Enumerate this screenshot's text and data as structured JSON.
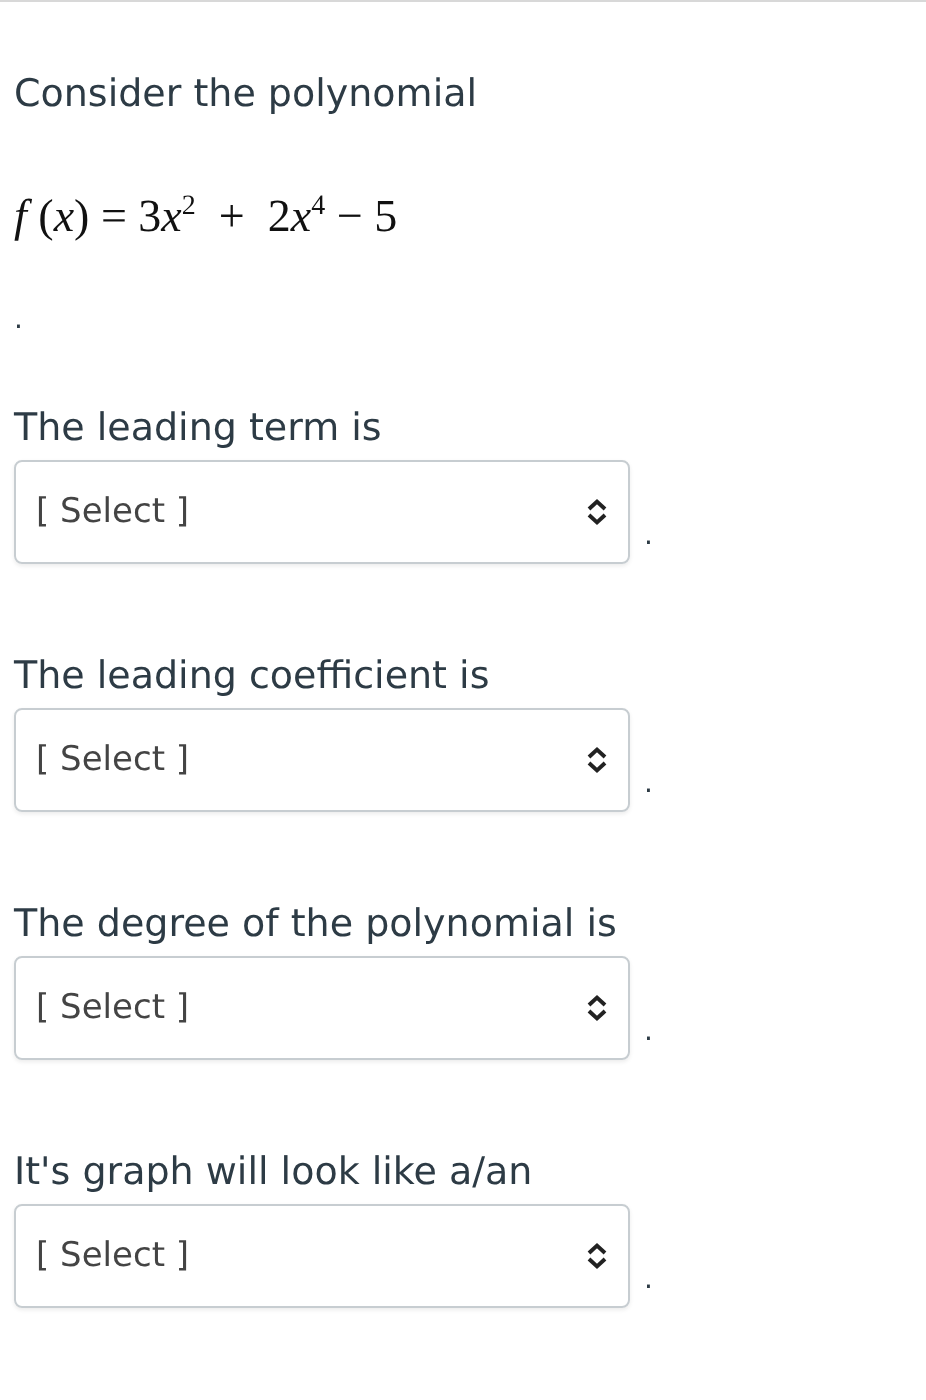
{
  "intro": "Consider the polynomial",
  "formula": [
    {
      "kind": "var",
      "text": "f"
    },
    {
      "kind": "plain",
      "text": " ("
    },
    {
      "kind": "var",
      "text": "x"
    },
    {
      "kind": "plain",
      "text": ") = 3"
    },
    {
      "kind": "var",
      "text": "x"
    },
    {
      "kind": "exp",
      "text": "2"
    },
    {
      "kind": "plain",
      "text": "  +  2"
    },
    {
      "kind": "var",
      "text": "x"
    },
    {
      "kind": "exp",
      "text": "4"
    },
    {
      "kind": "plain",
      "text": " − 5"
    }
  ],
  "formula_end": ".",
  "questions": [
    {
      "prompt": "The leading term is",
      "select": {
        "placeholder": "[ Select ]"
      },
      "end": "."
    },
    {
      "prompt": "The leading coefficient is",
      "select": {
        "placeholder": "[ Select ]"
      },
      "end": "."
    },
    {
      "prompt": "The degree of the polynomial is",
      "select": {
        "placeholder": "[ Select ]"
      },
      "end": "."
    },
    {
      "prompt": "It's graph will look like a/an",
      "select": {
        "placeholder": "[ Select ]"
      },
      "end": "."
    }
  ]
}
